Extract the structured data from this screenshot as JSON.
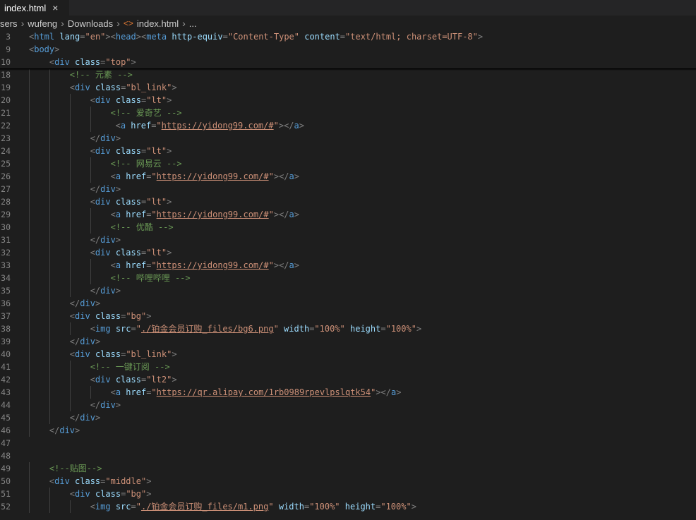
{
  "tab": {
    "label": "index.html",
    "close": "×"
  },
  "breadcrumb": {
    "items": [
      "sers",
      "wufeng",
      "Downloads",
      "index.html",
      "..."
    ]
  },
  "lines": [
    {
      "n": "3",
      "indent": 0,
      "tokens": [
        [
          "p",
          "<"
        ],
        [
          "t",
          "html"
        ],
        [
          "a",
          " lang"
        ],
        [
          "p",
          "="
        ],
        [
          "s",
          "\"en\""
        ],
        [
          "p",
          "><"
        ],
        [
          "t",
          "head"
        ],
        [
          "p",
          "><"
        ],
        [
          "t",
          "meta"
        ],
        [
          "a",
          " http-equiv"
        ],
        [
          "p",
          "="
        ],
        [
          "s",
          "\"Content-Type\""
        ],
        [
          "a",
          " content"
        ],
        [
          "p",
          "="
        ],
        [
          "s",
          "\"text/html; charset=UTF-8\""
        ],
        [
          "p",
          ">"
        ]
      ]
    },
    {
      "n": "9",
      "indent": 0,
      "tokens": [
        [
          "p",
          "<"
        ],
        [
          "t",
          "body"
        ],
        [
          "p",
          ">"
        ]
      ]
    },
    {
      "n": "10",
      "indent": 1,
      "tokens": [
        [
          "p",
          "<"
        ],
        [
          "t",
          "div"
        ],
        [
          "a",
          " class"
        ],
        [
          "p",
          "="
        ],
        [
          "s",
          "\"top\""
        ],
        [
          "p",
          ">"
        ]
      ]
    },
    {
      "n": "18",
      "indent": 2,
      "tokens": [
        [
          "c",
          "<!-- 元素 -->"
        ]
      ]
    },
    {
      "n": "19",
      "indent": 2,
      "tokens": [
        [
          "p",
          "<"
        ],
        [
          "t",
          "div"
        ],
        [
          "a",
          " class"
        ],
        [
          "p",
          "="
        ],
        [
          "s",
          "\"bl_link\""
        ],
        [
          "p",
          ">"
        ]
      ]
    },
    {
      "n": "20",
      "indent": 3,
      "tokens": [
        [
          "p",
          "<"
        ],
        [
          "t",
          "div"
        ],
        [
          "a",
          " class"
        ],
        [
          "p",
          "="
        ],
        [
          "s",
          "\"lt\""
        ],
        [
          "p",
          ">"
        ]
      ]
    },
    {
      "n": "21",
      "indent": 4,
      "tokens": [
        [
          "c",
          "<!-- 爱奇艺 -->"
        ]
      ]
    },
    {
      "n": "22",
      "indent": 4,
      "extra": " ",
      "tokens": [
        [
          "p",
          "<"
        ],
        [
          "t",
          "a"
        ],
        [
          "a",
          " href"
        ],
        [
          "p",
          "="
        ],
        [
          "s",
          "\""
        ],
        [
          "l",
          "https://yidong99.com/#"
        ],
        [
          "s",
          "\""
        ],
        [
          "p",
          "></"
        ],
        [
          "t",
          "a"
        ],
        [
          "p",
          ">"
        ]
      ]
    },
    {
      "n": "23",
      "indent": 3,
      "tokens": [
        [
          "p",
          "</"
        ],
        [
          "t",
          "div"
        ],
        [
          "p",
          ">"
        ]
      ]
    },
    {
      "n": "24",
      "indent": 3,
      "tokens": [
        [
          "p",
          "<"
        ],
        [
          "t",
          "div"
        ],
        [
          "a",
          " class"
        ],
        [
          "p",
          "="
        ],
        [
          "s",
          "\"lt\""
        ],
        [
          "p",
          ">"
        ]
      ]
    },
    {
      "n": "25",
      "indent": 4,
      "tokens": [
        [
          "c",
          "<!-- 网易云 -->"
        ]
      ]
    },
    {
      "n": "26",
      "indent": 4,
      "tokens": [
        [
          "p",
          "<"
        ],
        [
          "t",
          "a"
        ],
        [
          "a",
          " href"
        ],
        [
          "p",
          "="
        ],
        [
          "s",
          "\""
        ],
        [
          "l",
          "https://yidong99.com/#"
        ],
        [
          "s",
          "\""
        ],
        [
          "p",
          "></"
        ],
        [
          "t",
          "a"
        ],
        [
          "p",
          ">"
        ]
      ]
    },
    {
      "n": "27",
      "indent": 3,
      "tokens": [
        [
          "p",
          "</"
        ],
        [
          "t",
          "div"
        ],
        [
          "p",
          ">"
        ]
      ]
    },
    {
      "n": "28",
      "indent": 3,
      "tokens": [
        [
          "p",
          "<"
        ],
        [
          "t",
          "div"
        ],
        [
          "a",
          " class"
        ],
        [
          "p",
          "="
        ],
        [
          "s",
          "\"lt\""
        ],
        [
          "p",
          ">"
        ]
      ]
    },
    {
      "n": "29",
      "indent": 4,
      "tokens": [
        [
          "p",
          "<"
        ],
        [
          "t",
          "a"
        ],
        [
          "a",
          " href"
        ],
        [
          "p",
          "="
        ],
        [
          "s",
          "\""
        ],
        [
          "l",
          "https://yidong99.com/#"
        ],
        [
          "s",
          "\""
        ],
        [
          "p",
          "></"
        ],
        [
          "t",
          "a"
        ],
        [
          "p",
          ">"
        ]
      ]
    },
    {
      "n": "30",
      "indent": 4,
      "tokens": [
        [
          "c",
          "<!-- 优酷 -->"
        ]
      ]
    },
    {
      "n": "31",
      "indent": 3,
      "tokens": [
        [
          "p",
          "</"
        ],
        [
          "t",
          "div"
        ],
        [
          "p",
          ">"
        ]
      ]
    },
    {
      "n": "32",
      "indent": 3,
      "tokens": [
        [
          "p",
          "<"
        ],
        [
          "t",
          "div"
        ],
        [
          "a",
          " class"
        ],
        [
          "p",
          "="
        ],
        [
          "s",
          "\"lt\""
        ],
        [
          "p",
          ">"
        ]
      ]
    },
    {
      "n": "33",
      "indent": 4,
      "tokens": [
        [
          "p",
          "<"
        ],
        [
          "t",
          "a"
        ],
        [
          "a",
          " href"
        ],
        [
          "p",
          "="
        ],
        [
          "s",
          "\""
        ],
        [
          "l",
          "https://yidong99.com/#"
        ],
        [
          "s",
          "\""
        ],
        [
          "p",
          "></"
        ],
        [
          "t",
          "a"
        ],
        [
          "p",
          ">"
        ]
      ]
    },
    {
      "n": "34",
      "indent": 4,
      "tokens": [
        [
          "c",
          "<!-- 哔哩哔哩 -->"
        ]
      ]
    },
    {
      "n": "35",
      "indent": 3,
      "tokens": [
        [
          "p",
          "</"
        ],
        [
          "t",
          "div"
        ],
        [
          "p",
          ">"
        ]
      ]
    },
    {
      "n": "36",
      "indent": 2,
      "tokens": [
        [
          "p",
          "</"
        ],
        [
          "t",
          "div"
        ],
        [
          "p",
          ">"
        ]
      ]
    },
    {
      "n": "37",
      "indent": 2,
      "tokens": [
        [
          "p",
          "<"
        ],
        [
          "t",
          "div"
        ],
        [
          "a",
          " class"
        ],
        [
          "p",
          "="
        ],
        [
          "s",
          "\"bg\""
        ],
        [
          "p",
          ">"
        ]
      ]
    },
    {
      "n": "38",
      "indent": 3,
      "tokens": [
        [
          "p",
          "<"
        ],
        [
          "t",
          "img"
        ],
        [
          "a",
          " src"
        ],
        [
          "p",
          "="
        ],
        [
          "s",
          "\""
        ],
        [
          "l",
          "./铂金会员订购_files/bg6.png"
        ],
        [
          "s",
          "\""
        ],
        [
          "a",
          " width"
        ],
        [
          "p",
          "="
        ],
        [
          "s",
          "\"100%\""
        ],
        [
          "a",
          " height"
        ],
        [
          "p",
          "="
        ],
        [
          "s",
          "\"100%\""
        ],
        [
          "p",
          ">"
        ]
      ]
    },
    {
      "n": "39",
      "indent": 2,
      "tokens": [
        [
          "p",
          "</"
        ],
        [
          "t",
          "div"
        ],
        [
          "p",
          ">"
        ]
      ]
    },
    {
      "n": "40",
      "indent": 2,
      "tokens": [
        [
          "p",
          "<"
        ],
        [
          "t",
          "div"
        ],
        [
          "a",
          " class"
        ],
        [
          "p",
          "="
        ],
        [
          "s",
          "\"bl_link\""
        ],
        [
          "p",
          ">"
        ]
      ]
    },
    {
      "n": "41",
      "indent": 3,
      "tokens": [
        [
          "c",
          "<!-- 一键订阅 -->"
        ]
      ]
    },
    {
      "n": "42",
      "indent": 3,
      "tokens": [
        [
          "p",
          "<"
        ],
        [
          "t",
          "div"
        ],
        [
          "a",
          " class"
        ],
        [
          "p",
          "="
        ],
        [
          "s",
          "\"lt2\""
        ],
        [
          "p",
          ">"
        ]
      ]
    },
    {
      "n": "43",
      "indent": 4,
      "tokens": [
        [
          "p",
          "<"
        ],
        [
          "t",
          "a"
        ],
        [
          "a",
          " href"
        ],
        [
          "p",
          "="
        ],
        [
          "s",
          "\""
        ],
        [
          "l",
          "https://qr.alipay.com/1rb0989rpevlpslqtk54"
        ],
        [
          "s",
          "\""
        ],
        [
          "p",
          "></"
        ],
        [
          "t",
          "a"
        ],
        [
          "p",
          ">"
        ]
      ]
    },
    {
      "n": "44",
      "indent": 3,
      "tokens": [
        [
          "p",
          "</"
        ],
        [
          "t",
          "div"
        ],
        [
          "p",
          ">"
        ]
      ]
    },
    {
      "n": "45",
      "indent": 2,
      "tokens": [
        [
          "p",
          "</"
        ],
        [
          "t",
          "div"
        ],
        [
          "p",
          ">"
        ]
      ]
    },
    {
      "n": "46",
      "indent": 1,
      "tokens": [
        [
          "p",
          "</"
        ],
        [
          "t",
          "div"
        ],
        [
          "p",
          ">"
        ]
      ]
    },
    {
      "n": "47",
      "indent": 0,
      "tokens": []
    },
    {
      "n": "48",
      "indent": 0,
      "tokens": []
    },
    {
      "n": "49",
      "indent": 1,
      "tokens": [
        [
          "c",
          "<!--贴图-->"
        ]
      ]
    },
    {
      "n": "50",
      "indent": 1,
      "tokens": [
        [
          "p",
          "<"
        ],
        [
          "t",
          "div"
        ],
        [
          "a",
          " class"
        ],
        [
          "p",
          "="
        ],
        [
          "s",
          "\"middle\""
        ],
        [
          "p",
          ">"
        ]
      ]
    },
    {
      "n": "51",
      "indent": 2,
      "tokens": [
        [
          "p",
          "<"
        ],
        [
          "t",
          "div"
        ],
        [
          "a",
          " class"
        ],
        [
          "p",
          "="
        ],
        [
          "s",
          "\"bg\""
        ],
        [
          "p",
          ">"
        ]
      ]
    },
    {
      "n": "52",
      "indent": 3,
      "tokens": [
        [
          "p",
          "<"
        ],
        [
          "t",
          "img"
        ],
        [
          "a",
          " src"
        ],
        [
          "p",
          "="
        ],
        [
          "s",
          "\""
        ],
        [
          "l",
          "./铂金会员订购_files/m1.png"
        ],
        [
          "s",
          "\""
        ],
        [
          "a",
          " width"
        ],
        [
          "p",
          "="
        ],
        [
          "s",
          "\"100%\""
        ],
        [
          "a",
          " height"
        ],
        [
          "p",
          "="
        ],
        [
          "s",
          "\"100%\""
        ],
        [
          "p",
          ">"
        ]
      ]
    }
  ],
  "colors": {
    "tag": "#569cd6",
    "attr": "#9cdcfe",
    "string": "#ce9178",
    "comment": "#6a9955",
    "punct": "#808080",
    "background": "#1e1e1e"
  }
}
